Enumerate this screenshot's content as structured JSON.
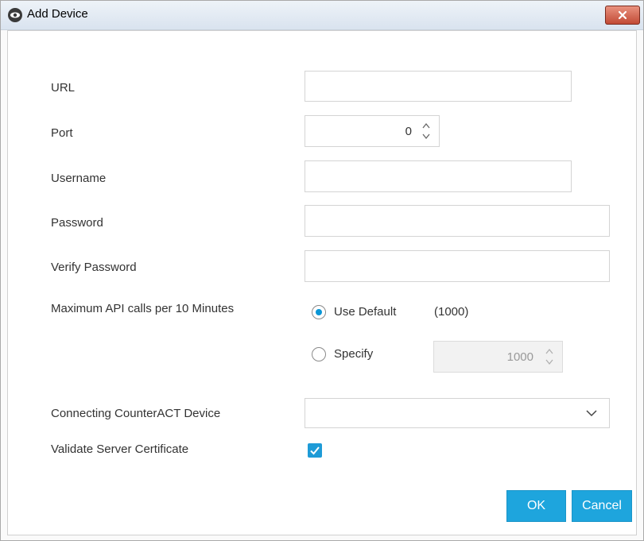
{
  "window": {
    "title": "Add Device"
  },
  "form": {
    "url_label": "URL",
    "url_value": "",
    "port_label": "Port",
    "port_value": "0",
    "username_label": "Username",
    "username_value": "",
    "password_label": "Password",
    "password_value": "",
    "verify_password_label": "Verify Password",
    "verify_password_value": "",
    "api_calls_label": "Maximum API calls per 10 Minutes",
    "use_default_label": "Use Default",
    "use_default_value": "(1000)",
    "specify_label": "Specify",
    "specify_value": "1000",
    "connecting_device_label": "Connecting CounterACT Device",
    "connecting_device_value": "",
    "validate_cert_label": "Validate Server Certificate",
    "validate_cert_checked": true
  },
  "buttons": {
    "ok": "OK",
    "cancel": "Cancel"
  },
  "colors": {
    "accent": "#1ea5dd",
    "close": "#c24a35"
  },
  "icons": {
    "title": "eye-icon",
    "close": "close-icon",
    "spinner": "spinner-arrows-icon",
    "dropdown": "chevron-down-icon",
    "check": "checkmark-icon"
  }
}
